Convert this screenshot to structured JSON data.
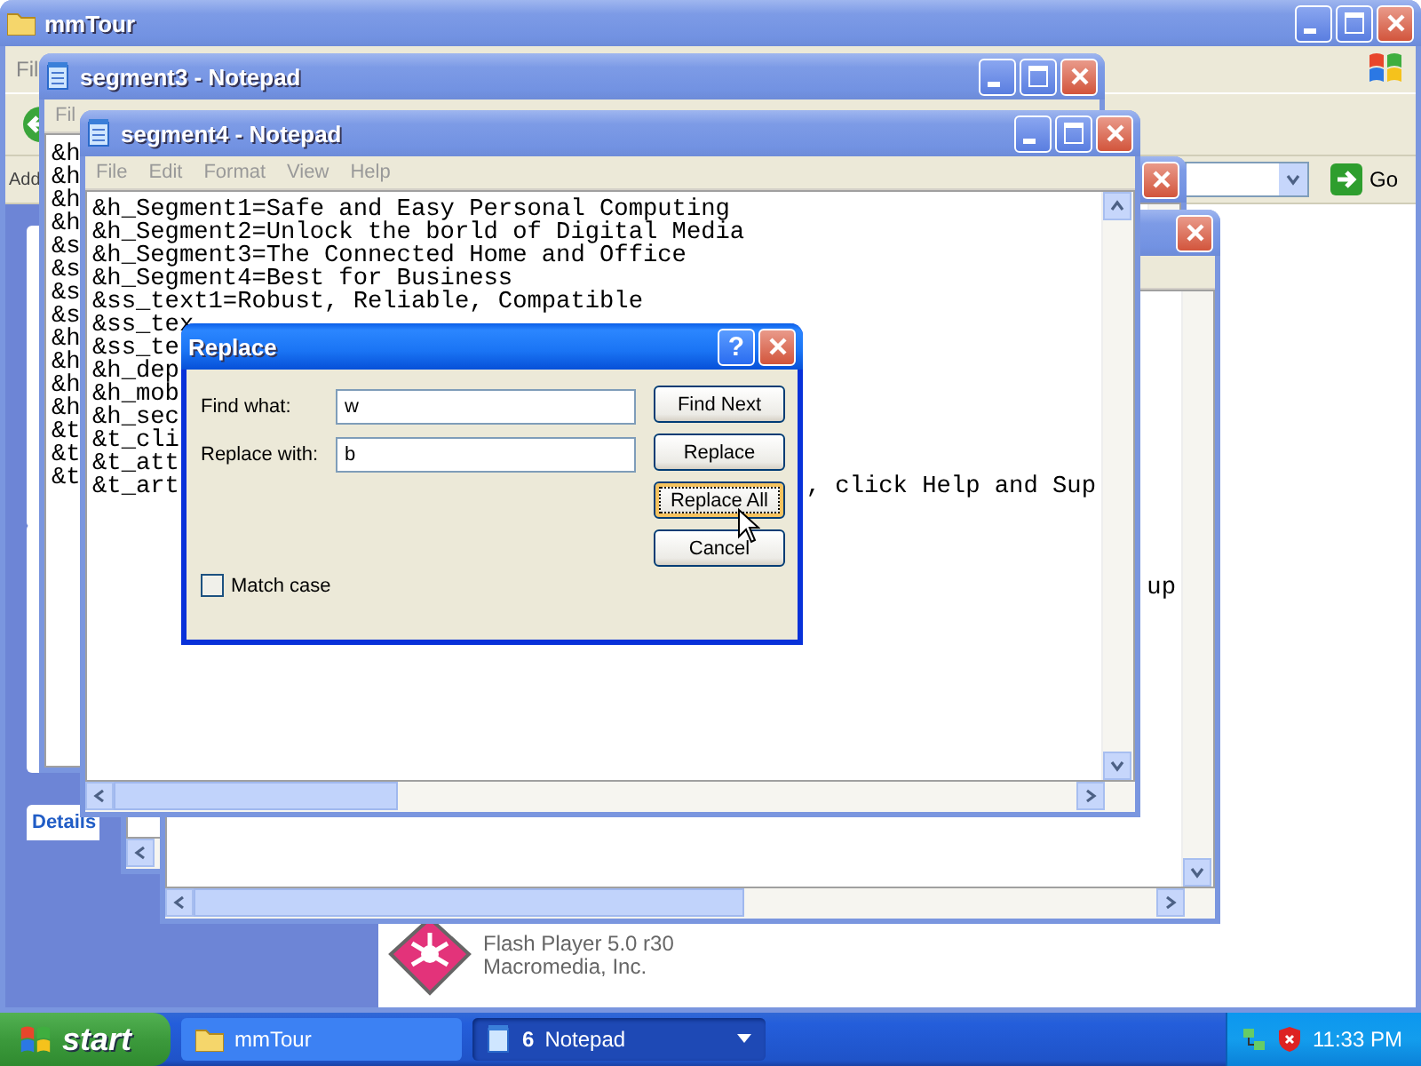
{
  "explorer": {
    "title": "mmTour",
    "menu_fragment": "Fil",
    "address_label_fragment": "Add",
    "go_button": "Go",
    "details_tab_fragment": "Details",
    "file": {
      "version": "Flash Player 5.0 r30",
      "company": "Macromedia, Inc."
    }
  },
  "back_window": {
    "text_fragment": "up"
  },
  "segment3": {
    "title": "segment3 - Notepad",
    "menu_fragment": "Fil",
    "line_prefixes": [
      "&h",
      "&h",
      "&h",
      "&h",
      "&s",
      "&s",
      "&s",
      "&s",
      "&h",
      "&h",
      "&h",
      "&h",
      "&t",
      "&t",
      "&t"
    ]
  },
  "segment4": {
    "title": "segment4 - Notepad",
    "menu": [
      "File",
      "Edit",
      "Format",
      "View",
      "Help"
    ],
    "lines": [
      {
        "left": "&h_Segment1=Safe and Easy Personal Computing"
      },
      {
        "left": "&h_Segment2=Unlock the borld of Digital Media"
      },
      {
        "left": "&h_Segment3=The Connected Home and Office"
      },
      {
        "left": "&h_Segment4=Best for Business"
      },
      {
        "left": "&ss_text1=Robust, Reliable, Compatible"
      },
      {
        "left": "&ss_tex"
      },
      {
        "left": "&ss_te"
      },
      {
        "left": "&h_dep"
      },
      {
        "left": "&h_mob"
      },
      {
        "left": "&h_sec"
      },
      {
        "left": "&t_cli"
      },
      {
        "left": "&t_att"
      },
      {
        "left": "&t_art",
        "right": ", click Help and Sup"
      }
    ]
  },
  "replace_dialog": {
    "title": "Replace",
    "help_button": "?",
    "find_label": "Find what:",
    "find_value": "w",
    "replace_label": "Replace with:",
    "replace_value": "b",
    "buttons": [
      {
        "label": "Find Next",
        "focused": false
      },
      {
        "label": "Replace",
        "focused": false
      },
      {
        "label": "Replace All",
        "focused": true
      },
      {
        "label": "Cancel",
        "focused": false
      }
    ],
    "match_case": {
      "label": "Match case",
      "checked": false
    }
  },
  "taskbar": {
    "start": "start",
    "tasks": [
      {
        "label": "mmTour",
        "selected": false
      },
      {
        "count": "6",
        "label": "Notepad",
        "selected": true
      }
    ],
    "clock": "11:33 PM"
  }
}
